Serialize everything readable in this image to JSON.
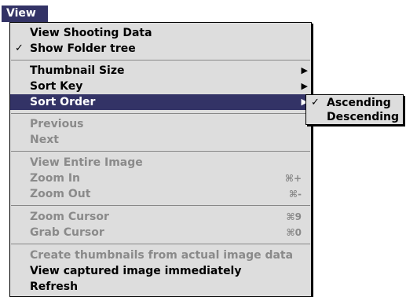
{
  "menubar": {
    "title": "View"
  },
  "menu": {
    "items": [
      {
        "label": "View Shooting Data"
      },
      {
        "label": "Show Folder tree",
        "check": "✓"
      },
      {
        "label": "Thumbnail Size",
        "arrow": "▶"
      },
      {
        "label": "Sort Key",
        "arrow": "▶"
      },
      {
        "label": "Sort Order",
        "arrow": "▶"
      },
      {
        "label": "Previous"
      },
      {
        "label": "Next"
      },
      {
        "label": "View Entire Image"
      },
      {
        "label": "Zoom In",
        "shortcut": "⌘+"
      },
      {
        "label": "Zoom Out",
        "shortcut": "⌘-"
      },
      {
        "label": "Zoom Cursor",
        "shortcut": "⌘9"
      },
      {
        "label": "Grab Cursor",
        "shortcut": "⌘0"
      },
      {
        "label": "Create thumbnails from actual image data"
      },
      {
        "label": "View captured image immediately"
      },
      {
        "label": "Refresh"
      }
    ]
  },
  "submenu": {
    "items": [
      {
        "label": "Ascending",
        "check": "✓"
      },
      {
        "label": "Descending"
      }
    ]
  },
  "colors": {
    "highlight": "#333366",
    "menu_bg": "#dddddd",
    "disabled_text": "#8a8a8a"
  }
}
